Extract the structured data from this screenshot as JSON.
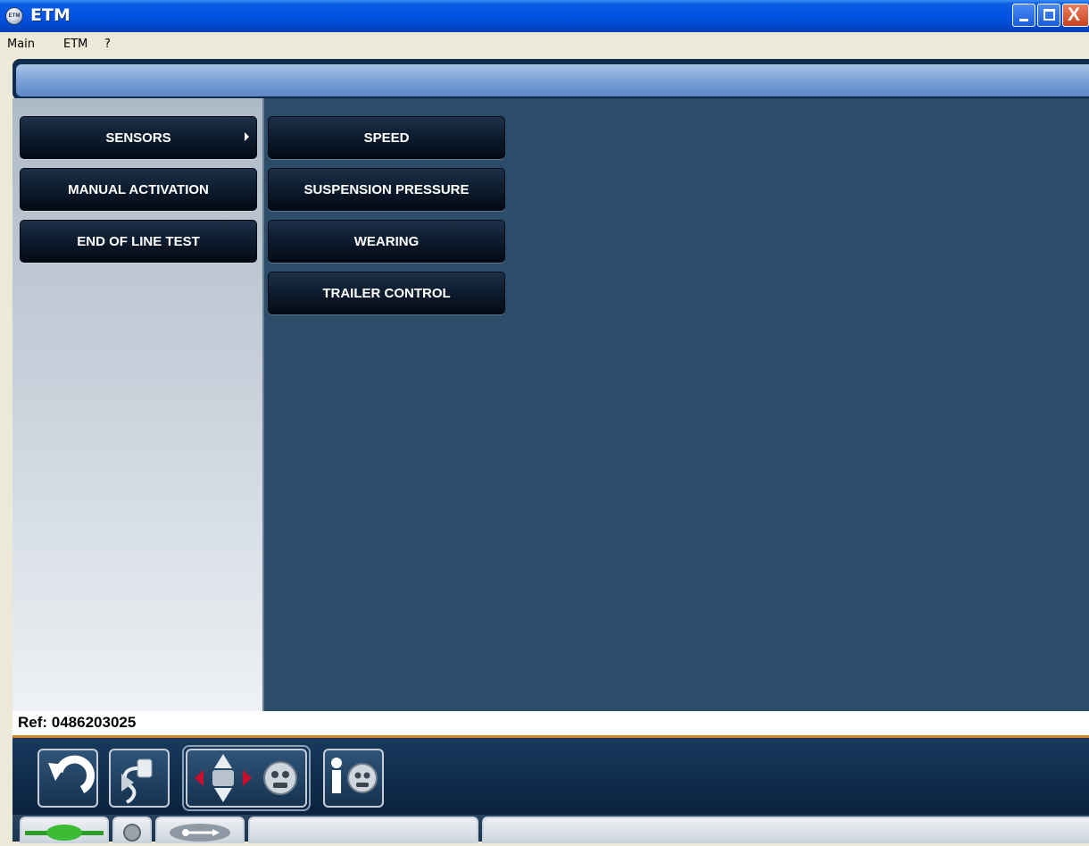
{
  "window": {
    "title": "ETM",
    "app_icon_label": "ETM",
    "controls": {
      "close_glyph": "X"
    }
  },
  "menubar": {
    "items": [
      "Main",
      "ETM",
      "?"
    ]
  },
  "left_menu": {
    "items": [
      {
        "label": "SENSORS",
        "has_submenu": true,
        "active": true
      },
      {
        "label": "MANUAL ACTIVATION",
        "has_submenu": false
      },
      {
        "label": "END OF LINE TEST",
        "has_submenu": false
      }
    ]
  },
  "submenu": {
    "items": [
      "SPEED",
      "SUSPENSION PRESSURE",
      "WEARING",
      "TRAILER CONTROL"
    ]
  },
  "ref": {
    "text": "Ref: 0486203025"
  },
  "toolbar": {
    "buttons": [
      {
        "icon": "back-arrow-icon"
      },
      {
        "icon": "connector-cable-icon"
      },
      {
        "icon": "move-arrows-icon"
      },
      {
        "icon": "info-icon"
      }
    ]
  },
  "statusbar": {
    "indicators": [
      "green-connection-icon",
      "grey-led-icon",
      "usb-icon"
    ]
  },
  "colors": {
    "content_bg": "#2c4d6a",
    "button_bg": "#0f1f33",
    "ref_underline": "#d9822b",
    "titlebar": "#0055e5"
  }
}
